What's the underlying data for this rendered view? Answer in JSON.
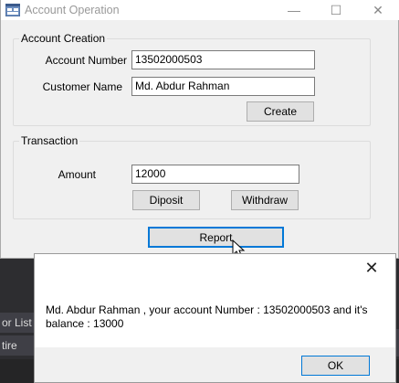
{
  "window": {
    "title": "Account Operation",
    "controls": {
      "minimize": "—",
      "maximize": "☐",
      "close": "✕"
    }
  },
  "account_creation": {
    "legend": "Account Creation",
    "account_number_label": "Account Number",
    "account_number_value": "13502000503",
    "customer_name_label": "Customer Name",
    "customer_name_value": "Md. Abdur Rahman",
    "create_label": "Create"
  },
  "transaction": {
    "legend": "Transaction",
    "amount_label": "Amount",
    "amount_value": "12000",
    "deposit_label": "Diposit",
    "withdraw_label": "Withdraw"
  },
  "report_label": "Report",
  "message_box": {
    "close": "✕",
    "text": "Md. Abdur Rahman , your account Number : 13502000503 and it's balance : 13000",
    "ok_label": "OK"
  },
  "background_ide": {
    "tab1": "or List",
    "tab2": "tire Sol"
  },
  "colors": {
    "accent": "#0078d7",
    "ide_dark": "#2d2d30"
  },
  "icons": [
    "app-icon",
    "close-icon",
    "minimize-icon",
    "maximize-icon",
    "mouse-cursor-icon"
  ]
}
